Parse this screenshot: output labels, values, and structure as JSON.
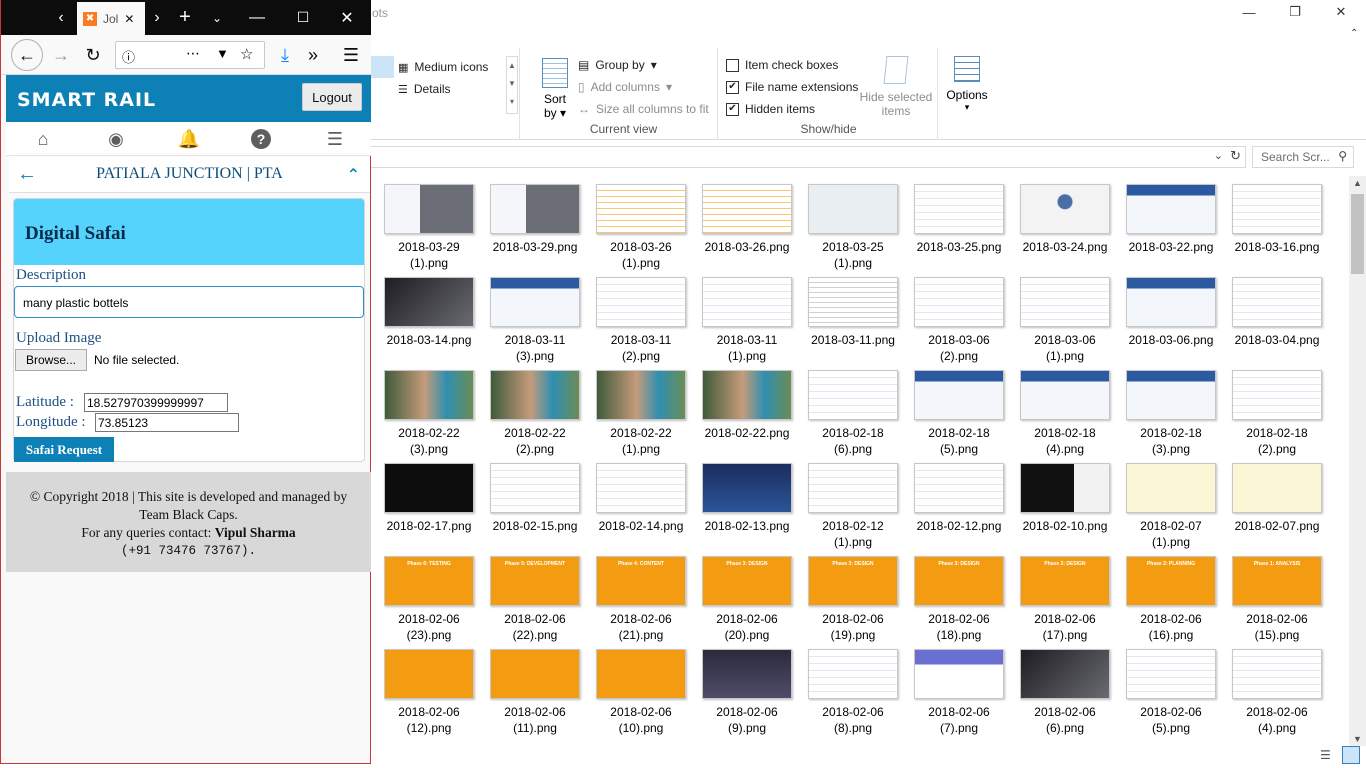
{
  "explorer": {
    "title_fragment": "ots",
    "ribbon": {
      "layout": {
        "items": [
          "Medium icons",
          "Details"
        ]
      },
      "current_view": {
        "label": "Current view",
        "sort_label": "Sort",
        "sort_sub": "by",
        "group_by": "Group by",
        "add_columns": "Add columns",
        "size_columns": "Size all columns to fit"
      },
      "show_hide": {
        "label": "Show/hide",
        "item_check_boxes": "Item check boxes",
        "item_check_boxes_checked": false,
        "file_name_extensions": "File name extensions",
        "file_name_extensions_checked": true,
        "hidden_items": "Hidden items",
        "hidden_items_checked": true,
        "hide_selected": "Hide selected",
        "hide_selected_sub": "items"
      },
      "options_label": "Options"
    },
    "search_placeholder": "Search Scr...",
    "files": [
      {
        "name": "2018-03-29\n(1).png",
        "thumb": "photo"
      },
      {
        "name": "2018-03-29.png",
        "thumb": "photo"
      },
      {
        "name": "2018-03-26\n(1).png",
        "thumb": "sheet"
      },
      {
        "name": "2018-03-26.png",
        "thumb": "sheet"
      },
      {
        "name": "2018-03-25\n(1).png",
        "thumb": "map"
      },
      {
        "name": "2018-03-25.png",
        "thumb": "web"
      },
      {
        "name": "2018-03-24.png",
        "thumb": "cert"
      },
      {
        "name": "2018-03-22.png",
        "thumb": "web-blue"
      },
      {
        "name": "2018-03-16.png",
        "thumb": "web"
      },
      {
        "name": "2018-03-14.png",
        "thumb": "photo-dark"
      },
      {
        "name": "2018-03-11\n(3).png",
        "thumb": "web-blue"
      },
      {
        "name": "2018-03-11\n(2).png",
        "thumb": "web"
      },
      {
        "name": "2018-03-11\n(1).png",
        "thumb": "web"
      },
      {
        "name": "2018-03-11.png",
        "thumb": "doc"
      },
      {
        "name": "2018-03-06\n(2).png",
        "thumb": "web"
      },
      {
        "name": "2018-03-06\n(1).png",
        "thumb": "web"
      },
      {
        "name": "2018-03-06.png",
        "thumb": "web-blue"
      },
      {
        "name": "2018-03-04.png",
        "thumb": "web"
      },
      {
        "name": "2018-02-22\n(3).png",
        "thumb": "couple"
      },
      {
        "name": "2018-02-22\n(2).png",
        "thumb": "couple"
      },
      {
        "name": "2018-02-22\n(1).png",
        "thumb": "couple"
      },
      {
        "name": "2018-02-22.png",
        "thumb": "couple"
      },
      {
        "name": "2018-02-18\n(6).png",
        "thumb": "web"
      },
      {
        "name": "2018-02-18\n(5).png",
        "thumb": "web-blue"
      },
      {
        "name": "2018-02-18\n(4).png",
        "thumb": "web-blue"
      },
      {
        "name": "2018-02-18\n(3).png",
        "thumb": "web-blue"
      },
      {
        "name": "2018-02-18\n(2).png",
        "thumb": "web"
      },
      {
        "name": "2018-02-17.png",
        "thumb": "black"
      },
      {
        "name": "2018-02-15.png",
        "thumb": "web"
      },
      {
        "name": "2018-02-14.png",
        "thumb": "web"
      },
      {
        "name": "2018-02-13.png",
        "thumb": "cricket"
      },
      {
        "name": "2018-02-12\n(1).png",
        "thumb": "web"
      },
      {
        "name": "2018-02-12.png",
        "thumb": "web"
      },
      {
        "name": "2018-02-10.png",
        "thumb": "video"
      },
      {
        "name": "2018-02-07\n(1).png",
        "thumb": "yellow"
      },
      {
        "name": "2018-02-07.png",
        "thumb": "yellow"
      },
      {
        "name": "2018-02-06\n(23).png",
        "thumb": "orange",
        "caption": "Phase 6: TESTING"
      },
      {
        "name": "2018-02-06\n(22).png",
        "thumb": "orange",
        "caption": "Phase 5: DEVELOPMENT"
      },
      {
        "name": "2018-02-06\n(21).png",
        "thumb": "orange",
        "caption": "Phase 4: CONTENT"
      },
      {
        "name": "2018-02-06\n(20).png",
        "thumb": "orange",
        "caption": "Phase 3: DESIGN"
      },
      {
        "name": "2018-02-06\n(19).png",
        "thumb": "orange",
        "caption": "Phase 3: DESIGN"
      },
      {
        "name": "2018-02-06\n(18).png",
        "thumb": "orange",
        "caption": "Phase 3: DESIGN"
      },
      {
        "name": "2018-02-06\n(17).png",
        "thumb": "orange",
        "caption": "Phase 3: DESIGN"
      },
      {
        "name": "2018-02-06\n(16).png",
        "thumb": "orange",
        "caption": "Phase 2: PLANNING"
      },
      {
        "name": "2018-02-06\n(15).png",
        "thumb": "orange",
        "caption": "Phase 1: ANALYSIS"
      },
      {
        "name": "2018-02-06\n(12).png",
        "thumb": "orange"
      },
      {
        "name": "2018-02-06\n(11).png",
        "thumb": "orange"
      },
      {
        "name": "2018-02-06\n(10).png",
        "thumb": "orange"
      },
      {
        "name": "2018-02-06\n(9).png",
        "thumb": "dark-ui"
      },
      {
        "name": "2018-02-06\n(8).png",
        "thumb": "web"
      },
      {
        "name": "2018-02-06\n(7).png",
        "thumb": "web-purple"
      },
      {
        "name": "2018-02-06\n(6).png",
        "thumb": "photo-dark"
      },
      {
        "name": "2018-02-06\n(5).png",
        "thumb": "web"
      },
      {
        "name": "2018-02-06\n(4).png",
        "thumb": "web"
      }
    ]
  },
  "firefox": {
    "tab_title": "Jol",
    "app": {
      "brand": "SMART RAIL",
      "logout": "Logout",
      "station": "PATIALA JUNCTION | PTA",
      "form": {
        "title": "Digital Safai",
        "description_label": "Description",
        "description_value": "many plastic bottels",
        "upload_label": "Upload Image",
        "browse": "Browse...",
        "no_file": "No file selected.",
        "latitude_label": "Latitude :",
        "latitude_value": "18.527970399999997",
        "longitude_label": "Longitude :",
        "longitude_value": "73.85123",
        "submit": "Safai Request"
      },
      "footer": {
        "line1": "© Copyright 2018 | This site is developed and managed by",
        "line2": "Team Black Caps.",
        "line3_prefix": "For any queries contact: ",
        "contact_name": "Vipul Sharma",
        "phone": "(+91 73476 73767)."
      }
    }
  },
  "colors": {
    "brand_blue": "#0d81b6",
    "card_header": "#55d3fd",
    "thumb_orange": "#f39c12"
  }
}
